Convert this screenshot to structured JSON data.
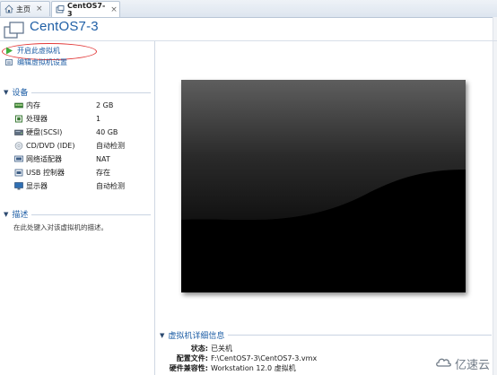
{
  "tabs": [
    {
      "label": "主页",
      "icon": "home-icon",
      "active": false
    },
    {
      "label": "CentOS7-3",
      "icon": "vm-tab-icon",
      "active": true
    }
  ],
  "vm": {
    "title": "CentOS7-3"
  },
  "actions": {
    "power_on": "开启此虚拟机",
    "edit_settings": "编辑虚拟机设置"
  },
  "devices": {
    "header": "设备",
    "items": [
      {
        "name": "内存",
        "value": "2 GB",
        "icon": "memory-icon"
      },
      {
        "name": "处理器",
        "value": "1",
        "icon": "processor-icon"
      },
      {
        "name": "硬盘(SCSI)",
        "value": "40 GB",
        "icon": "hard-disk-icon"
      },
      {
        "name": "CD/DVD (IDE)",
        "value": "自动检测",
        "icon": "cd-dvd-icon"
      },
      {
        "name": "网络适配器",
        "value": "NAT",
        "icon": "network-adapter-icon"
      },
      {
        "name": "USB 控制器",
        "value": "存在",
        "icon": "usb-controller-icon"
      },
      {
        "name": "显示器",
        "value": "自动检测",
        "icon": "display-icon"
      }
    ]
  },
  "description": {
    "header": "描述",
    "placeholder": "在此处键入对该虚拟机的描述。"
  },
  "details": {
    "header": "虚拟机详细信息",
    "rows": [
      {
        "key": "状态:",
        "value": "已关机"
      },
      {
        "key": "配置文件:",
        "value": "F:\\CentOS7-3\\CentOS7-3.vmx"
      },
      {
        "key": "硬件兼容性:",
        "value": "Workstation 12.0 虚拟机"
      }
    ]
  },
  "watermark": {
    "text": "亿速云"
  },
  "colors": {
    "accent": "#1f5fa6",
    "highlight_circle": "#e23a3a",
    "preview_bg": "#000000"
  }
}
